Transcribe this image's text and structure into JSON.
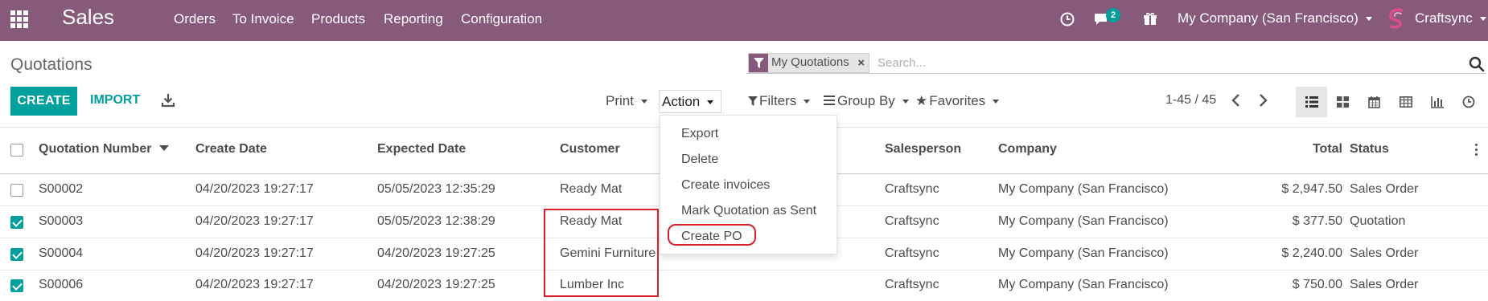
{
  "navbar": {
    "app_name": "Sales",
    "menu": [
      "Orders",
      "To Invoice",
      "Products",
      "Reporting",
      "Configuration"
    ],
    "messages_badge": "2",
    "company": "My Company (San Francisco)",
    "user": "Craftsync",
    "background_color": "#875a7b"
  },
  "breadcrumb": "Quotations",
  "search": {
    "facet_label": "My Quotations",
    "placeholder": "Search..."
  },
  "buttons": {
    "create": "CREATE",
    "import": "IMPORT"
  },
  "control": {
    "print": "Print",
    "action": "Action",
    "filters": "Filters",
    "group_by": "Group By",
    "favorites": "Favorites",
    "pager": "1-45 / 45"
  },
  "action_menu": [
    "Export",
    "Delete",
    "Create invoices",
    "Mark Quotation as Sent",
    "Create PO"
  ],
  "table": {
    "columns": [
      "Quotation Number",
      "Create Date",
      "Expected Date",
      "Customer",
      "Salesperson",
      "Company",
      "Total",
      "Status"
    ],
    "rows": [
      {
        "number": "S00002",
        "create_date": "04/20/2023 19:27:17",
        "expected_date": "05/05/2023 12:35:29",
        "customer": "Ready Mat",
        "salesperson": "Craftsync",
        "company": "My Company (San Francisco)",
        "total": "$ 2,947.50",
        "status": "Sales Order",
        "selected": false
      },
      {
        "number": "S00003",
        "create_date": "04/20/2023 19:27:17",
        "expected_date": "05/05/2023 12:38:29",
        "customer": "Ready Mat",
        "salesperson": "Craftsync",
        "company": "My Company (San Francisco)",
        "total": "$ 377.50",
        "status": "Quotation",
        "selected": true
      },
      {
        "number": "S00004",
        "create_date": "04/20/2023 19:27:17",
        "expected_date": "04/20/2023 19:27:25",
        "customer": "Gemini Furniture",
        "salesperson": "Craftsync",
        "company": "My Company (San Francisco)",
        "total": "$ 2,240.00",
        "status": "Sales Order",
        "selected": true
      },
      {
        "number": "S00006",
        "create_date": "04/20/2023 19:27:17",
        "expected_date": "04/20/2023 19:27:25",
        "customer": "Lumber Inc",
        "salesperson": "Craftsync",
        "company": "My Company (San Francisco)",
        "total": "$ 750.00",
        "status": "Sales Order",
        "selected": true
      }
    ]
  },
  "icons": [
    "apps-grid-icon",
    "clock-icon",
    "chat-icon",
    "gift-icon",
    "craftsync-logo-icon",
    "filter-icon",
    "close-icon",
    "search-icon",
    "download-icon",
    "chevron-left-icon",
    "chevron-right-icon",
    "list-view-icon",
    "kanban-view-icon",
    "calendar-view-icon",
    "pivot-view-icon",
    "graph-view-icon",
    "activity-view-icon",
    "sort-desc-icon",
    "kebab-icon"
  ],
  "colors": {
    "primary": "#00a09d",
    "brand": "#875a7b",
    "annotation": "#d9202a"
  }
}
